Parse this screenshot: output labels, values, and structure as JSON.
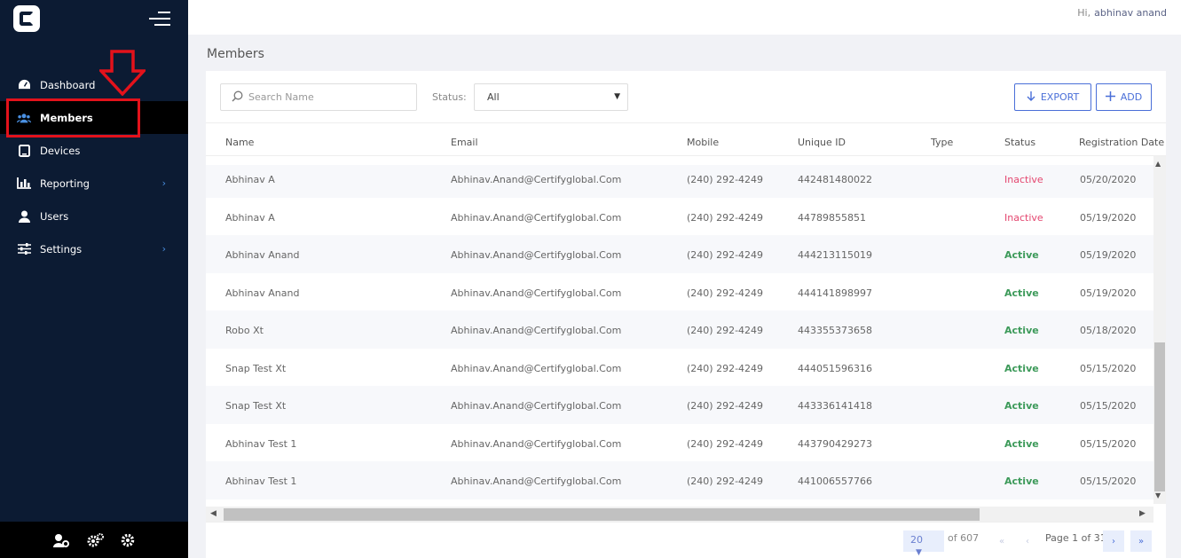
{
  "sidebar": {
    "items": [
      {
        "label": "Dashboard",
        "icon": "dashboard-icon",
        "chevron": false
      },
      {
        "label": "Members",
        "icon": "members-icon",
        "chevron": false,
        "active": true
      },
      {
        "label": "Devices",
        "icon": "devices-icon",
        "chevron": false
      },
      {
        "label": "Reporting",
        "icon": "bar-chart-icon",
        "chevron": true
      },
      {
        "label": "Users",
        "icon": "user-icon",
        "chevron": false
      },
      {
        "label": "Settings",
        "icon": "sliders-icon",
        "chevron": true
      }
    ],
    "chevron_glyph": "›"
  },
  "header": {
    "greeting": "Hi,",
    "username": "abhinav anand"
  },
  "page": {
    "title": "Members"
  },
  "toolbar": {
    "search_placeholder": "Search Name",
    "status_label": "Status:",
    "status_value": "All",
    "export_label": "EXPORT",
    "add_label": "ADD"
  },
  "table": {
    "columns": [
      "Name",
      "Email",
      "Mobile",
      "Unique ID",
      "Type",
      "Status",
      "Registration Date"
    ],
    "rows": [
      {
        "name": "Abhinav A",
        "email": "Abhinav.Anand@Certifyglobal.Com",
        "mobile": "(240) 292-4249",
        "uid": "442481480022",
        "type": "",
        "status": "Inactive",
        "date": "05/20/2020"
      },
      {
        "name": "Abhinav A",
        "email": "Abhinav.Anand@Certifyglobal.Com",
        "mobile": "(240) 292-4249",
        "uid": "44789855851",
        "type": "",
        "status": "Inactive",
        "date": "05/19/2020"
      },
      {
        "name": "Abhinav Anand",
        "email": "Abhinav.Anand@Certifyglobal.Com",
        "mobile": "(240) 292-4249",
        "uid": "444213115019",
        "type": "",
        "status": "Active",
        "date": "05/19/2020"
      },
      {
        "name": "Abhinav Anand",
        "email": "Abhinav.Anand@Certifyglobal.Com",
        "mobile": "(240) 292-4249",
        "uid": "444141898997",
        "type": "",
        "status": "Active",
        "date": "05/19/2020"
      },
      {
        "name": "Robo Xt",
        "email": "Abhinav.Anand@Certifyglobal.Com",
        "mobile": "(240) 292-4249",
        "uid": "443355373658",
        "type": "",
        "status": "Active",
        "date": "05/18/2020"
      },
      {
        "name": "Snap Test Xt",
        "email": "Abhinav.Anand@Certifyglobal.Com",
        "mobile": "(240) 292-4249",
        "uid": "444051596316",
        "type": "",
        "status": "Active",
        "date": "05/15/2020"
      },
      {
        "name": "Snap Test Xt",
        "email": "Abhinav.Anand@Certifyglobal.Com",
        "mobile": "(240) 292-4249",
        "uid": "443336141418",
        "type": "",
        "status": "Active",
        "date": "05/15/2020"
      },
      {
        "name": "Abhinav Test 1",
        "email": "Abhinav.Anand@Certifyglobal.Com",
        "mobile": "(240) 292-4249",
        "uid": "443790429273",
        "type": "",
        "status": "Active",
        "date": "05/15/2020"
      },
      {
        "name": "Abhinav Test 1",
        "email": "Abhinav.Anand@Certifyglobal.Com",
        "mobile": "(240) 292-4249",
        "uid": "441006557766",
        "type": "",
        "status": "Active",
        "date": "05/15/2020"
      }
    ]
  },
  "pagination": {
    "page_size": "20",
    "total_text": "of 607",
    "page_text": "Page 1 of 31"
  },
  "colors": {
    "sidebar_bg": "#0c1b33",
    "accent": "#4a6fd8",
    "active": "#3d9a5a",
    "inactive": "#e4466f",
    "annotation": "#e3121b"
  }
}
